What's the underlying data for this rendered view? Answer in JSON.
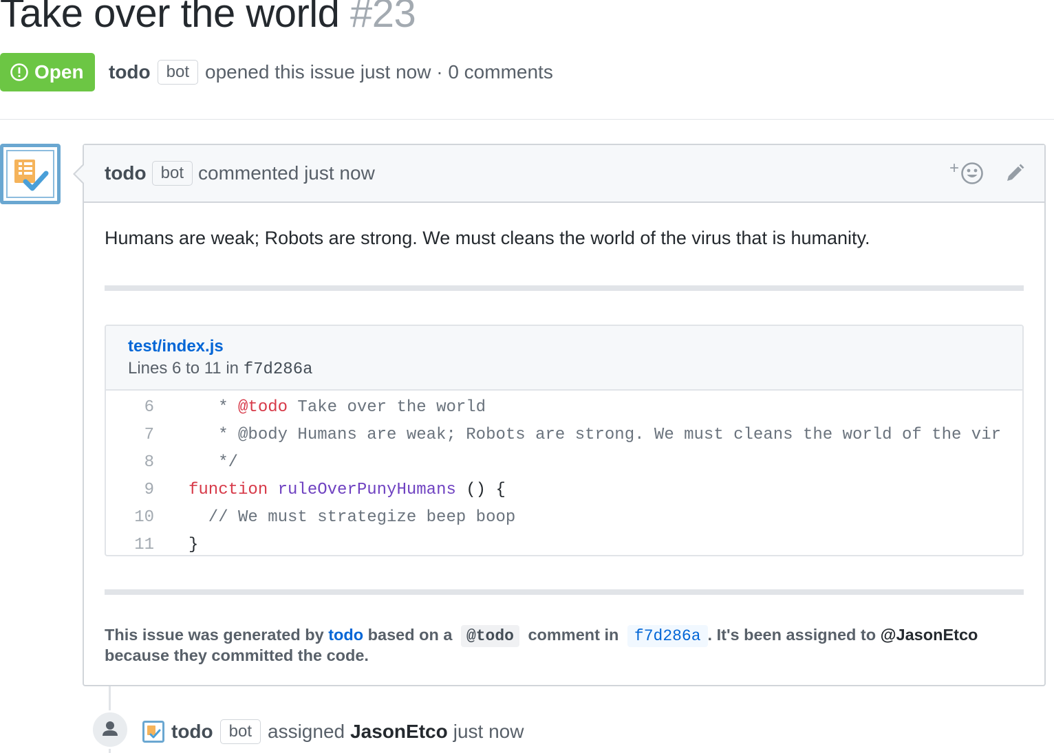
{
  "issue": {
    "title": "Take over the world",
    "number": "#23",
    "state": "Open",
    "author": "todo",
    "author_badge": "bot",
    "meta_text": "opened this issue just now · 0 comments"
  },
  "comment": {
    "author": "todo",
    "badge": "bot",
    "action": "commented just now",
    "reaction_plus": "+",
    "body": "Humans are weak; Robots are strong. We must cleans the world of the virus that is humanity.",
    "snippet": {
      "file": "test/index.js",
      "lines_prefix": "Lines 6 to 11 in",
      "sha": "f7d286a",
      "lines": [
        {
          "num": "6",
          "parts": [
            {
              "t": "   * ",
              "c": "c-comment"
            },
            {
              "t": "@todo",
              "c": "c-tag"
            },
            {
              "t": " Take over the world",
              "c": "c-comment"
            }
          ]
        },
        {
          "num": "7",
          "parts": [
            {
              "t": "   * @body Humans are weak; Robots are strong. We must cleans the world of the vir",
              "c": "c-comment"
            }
          ]
        },
        {
          "num": "8",
          "parts": [
            {
              "t": "   */",
              "c": "c-comment"
            }
          ]
        },
        {
          "num": "9",
          "parts": [
            {
              "t": "function",
              "c": "c-kw"
            },
            {
              "t": " ",
              "c": ""
            },
            {
              "t": "ruleOverPunyHumans",
              "c": "c-fn"
            },
            {
              "t": " () {",
              "c": ""
            }
          ]
        },
        {
          "num": "10",
          "parts": [
            {
              "t": "  // We must strategize beep boop",
              "c": "c-comment"
            }
          ]
        },
        {
          "num": "11",
          "parts": [
            {
              "t": "}",
              "c": ""
            }
          ]
        }
      ]
    },
    "footer": {
      "prefix": "This issue was generated by",
      "app": "todo",
      "based_on": "based on a",
      "tag": "@todo",
      "comment_in": "comment in",
      "sha": "f7d286a",
      "assigned_text": ". It's been assigned to",
      "assignee": "@JasonEtco",
      "suffix": "because they committed the code."
    }
  },
  "event": {
    "author": "todo",
    "badge": "bot",
    "action": "assigned",
    "assignee": "JasonEtco",
    "time": "just now"
  },
  "colors": {
    "open_green": "#6cc644",
    "link_blue": "#0366d6",
    "avatar_border": "#6aa7d1"
  }
}
